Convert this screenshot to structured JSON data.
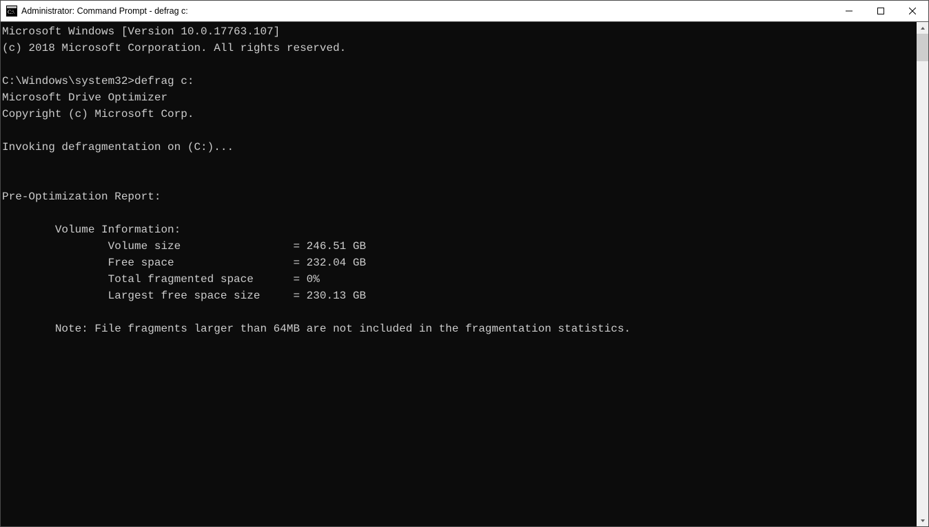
{
  "window": {
    "title": "Administrator: Command Prompt - defrag  c:"
  },
  "terminal": {
    "lines": [
      "Microsoft Windows [Version 10.0.17763.107]",
      "(c) 2018 Microsoft Corporation. All rights reserved.",
      "",
      "C:\\Windows\\system32>defrag c:",
      "Microsoft Drive Optimizer",
      "Copyright (c) Microsoft Corp.",
      "",
      "Invoking defragmentation on (C:)...",
      "",
      "",
      "Pre-Optimization Report:",
      "",
      "        Volume Information:",
      "                Volume size                 = 246.51 GB",
      "                Free space                  = 232.04 GB",
      "                Total fragmented space      = 0%",
      "                Largest free space size     = 230.13 GB",
      "",
      "        Note: File fragments larger than 64MB are not included in the fragmentation statistics."
    ]
  }
}
